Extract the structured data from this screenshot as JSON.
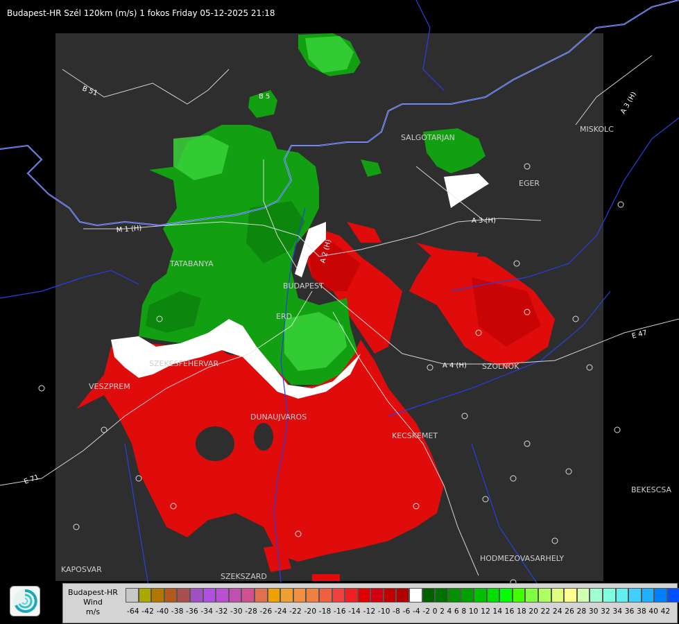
{
  "header": {
    "title": "Budapest-HR Szél 120km (m/s) 1 fokos Friday 05-12-2025 21:18"
  },
  "cities": [
    {
      "name": "SALGOTARJAN"
    },
    {
      "name": "MISKOLC"
    },
    {
      "name": "EGER"
    },
    {
      "name": "TATABANYA"
    },
    {
      "name": "BUDAPEST"
    },
    {
      "name": "ERD"
    },
    {
      "name": "SZEKESFEHERVAR"
    },
    {
      "name": "VESZPREM"
    },
    {
      "name": "DUNAUJVAROS"
    },
    {
      "name": "KECSKEMET"
    },
    {
      "name": "SZOLNOK"
    },
    {
      "name": "KAPOSVAR"
    },
    {
      "name": "SZEKSZARD"
    },
    {
      "name": "HODMEZOVASARHELY"
    },
    {
      "name": "BEKESCSA"
    }
  ],
  "roads": [
    {
      "name": "B 51"
    },
    {
      "name": "B 5"
    },
    {
      "name": "A 3 (H)"
    },
    {
      "name": "A 3 (H)"
    },
    {
      "name": "A 4 (H)"
    },
    {
      "name": "E 47"
    },
    {
      "name": "A 2 (H)"
    },
    {
      "name": "M 1 (H)"
    },
    {
      "name": "E 71"
    }
  ],
  "legend": {
    "title_line1": "Budapest-HR",
    "title_line2": "Wind",
    "title_line3": "m/s",
    "tick_text": "-64 -42 -40 -38 -36 -34 -32 -30 -28 -26 -24 -22 -20 -18 -16 -14 -12 -10  -8  -6  -4  -2   0   2   4   6   8  10  12  14  16  18  20  22  24  26  28  30  32  34  36  38  40  42",
    "colors": [
      "#c8c8c8",
      "#a8a800",
      "#b07800",
      "#b05a20",
      "#a85050",
      "#a050c0",
      "#b050e0",
      "#b850d0",
      "#c050b0",
      "#d05090",
      "#e07050",
      "#f0a000",
      "#f0a030",
      "#f09040",
      "#f08040",
      "#f06040",
      "#f04040",
      "#f02020",
      "#e00000",
      "#d00010",
      "#c00000",
      "#b00000",
      "#ffffff",
      "#006000",
      "#007000",
      "#009000",
      "#00a000",
      "#00c000",
      "#00e000",
      "#00ff00",
      "#40ff00",
      "#80ff40",
      "#b0ff60",
      "#e0ff80",
      "#ffff90",
      "#d0ffb0",
      "#a0ffd0",
      "#80ffe0",
      "#60f0f0",
      "#40d0ff",
      "#20b0ff",
      "#0080ff",
      "#0050ff",
      "#0020ff"
    ]
  }
}
